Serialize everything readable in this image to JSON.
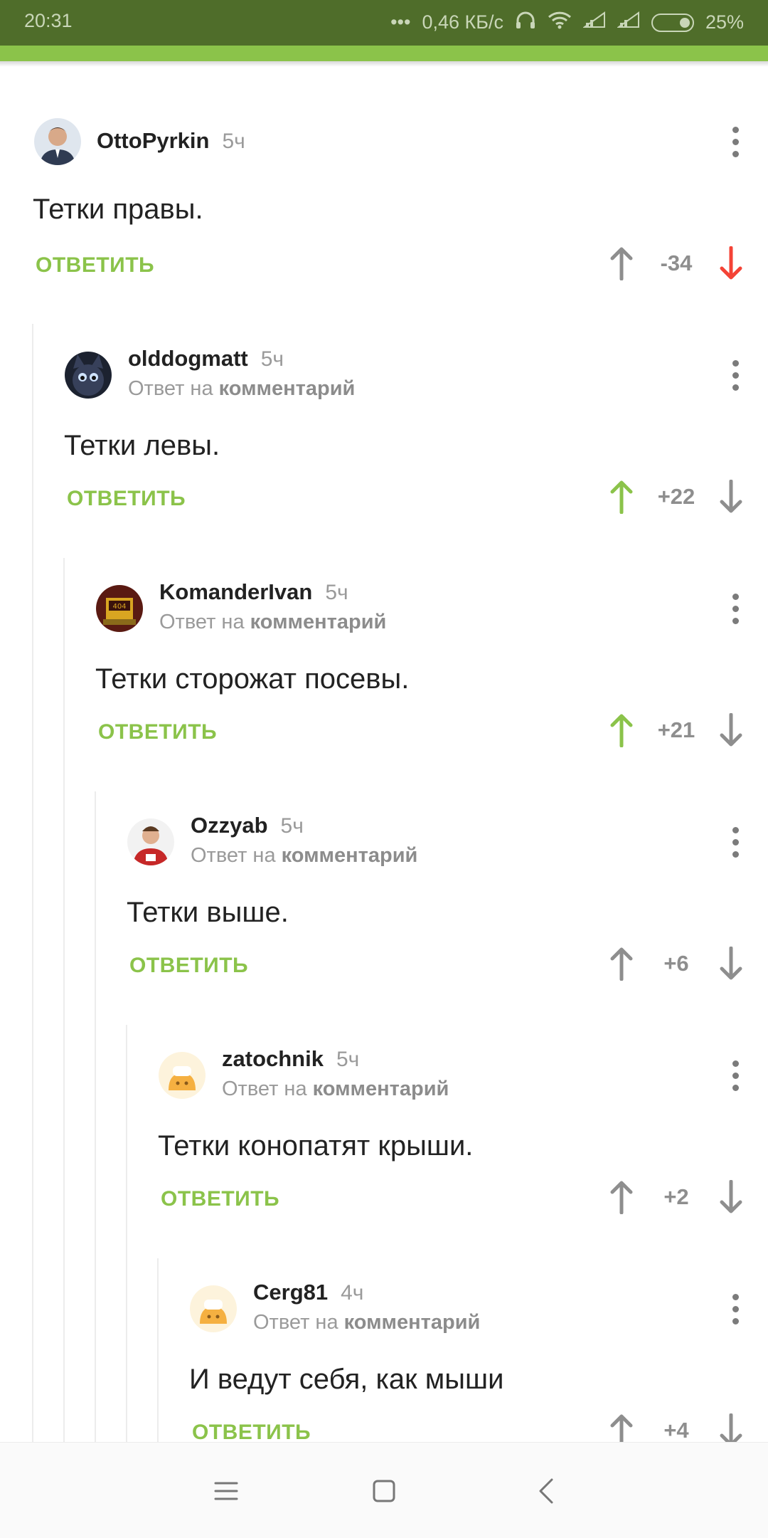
{
  "status_bar": {
    "time": "20:31",
    "network_speed": "0,46 КБ/с",
    "battery": "25%"
  },
  "colors": {
    "accent": "#8bc34a",
    "downvote": "#f44336",
    "statusbar": "#4f6d2a"
  },
  "common": {
    "reply_label": "ОТВЕТИТЬ",
    "reply_prefix": "Ответ на",
    "reply_target": "комментарий"
  },
  "comments": [
    {
      "author": "OttoPyrkin",
      "time": "5ч",
      "text": "Тетки правы.",
      "score": "-34",
      "vote": "down"
    },
    {
      "author": "olddogmatt",
      "time": "5ч",
      "text": "Тетки левы.",
      "score": "+22",
      "vote": "up"
    },
    {
      "author": "KomanderIvan",
      "time": "5ч",
      "text": "Тетки сторожат посевы.",
      "score": "+21",
      "vote": "up"
    },
    {
      "author": "Ozzyab",
      "time": "5ч",
      "text": "Тетки выше.",
      "score": "+6",
      "vote": "none"
    },
    {
      "author": "zatochnik",
      "time": "5ч",
      "text": "Тетки конопатят крыши.",
      "score": "+2",
      "vote": "none"
    },
    {
      "author": "Cerg81",
      "time": "4ч",
      "text": "И ведут себя, как мыши",
      "score": "+4",
      "vote": "none"
    }
  ],
  "nav": {
    "icons": [
      "menu-icon",
      "home-square-icon",
      "back-chevron-icon"
    ]
  }
}
